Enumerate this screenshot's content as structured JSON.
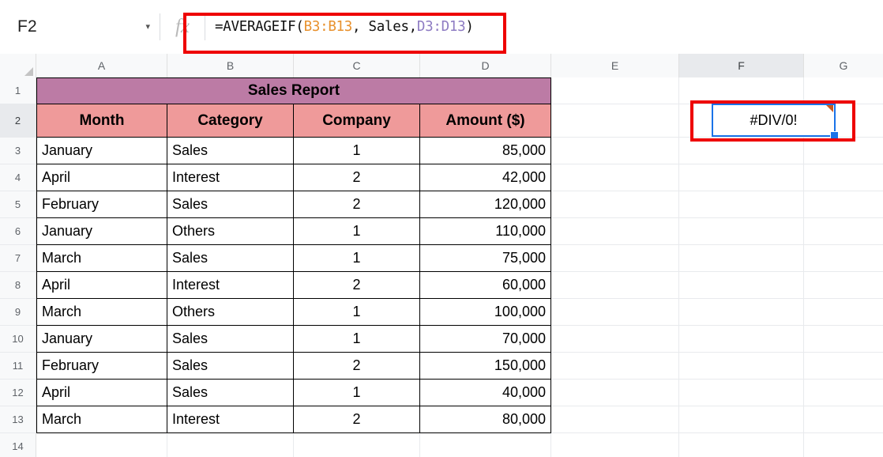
{
  "formula_bar": {
    "name_box_value": "F2",
    "name_box_caret": "▾",
    "fx_label": "fx",
    "formula_prefix": "=AVERAGEIF(",
    "formula_ref1": "B3:B13",
    "formula_mid": ", Sales,",
    "formula_ref2": "D3:D13",
    "formula_suffix": ")",
    "ref1_color": "#e8912d",
    "ref2_color": "#8e7cc3"
  },
  "grid": {
    "columns": [
      "A",
      "B",
      "C",
      "D",
      "E",
      "F",
      "G"
    ],
    "selected_column": "F",
    "selected_row": "2",
    "row_numbers": [
      "1",
      "2",
      "3",
      "4",
      "5",
      "6",
      "7",
      "8",
      "9",
      "10",
      "11",
      "12",
      "13",
      "14"
    ]
  },
  "sheet": {
    "title": "Sales Report",
    "title_bg": "#bc7ba5",
    "header_bg": "#ef9a9a",
    "headers": [
      "Month",
      "Category",
      "Company",
      "Amount ($)"
    ],
    "rows": [
      {
        "month": "January",
        "category": "Sales",
        "company": "1",
        "amount": "85,000"
      },
      {
        "month": "April",
        "category": "Interest",
        "company": "2",
        "amount": "42,000"
      },
      {
        "month": "February",
        "category": "Sales",
        "company": "2",
        "amount": "120,000"
      },
      {
        "month": "January",
        "category": "Others",
        "company": "1",
        "amount": "110,000"
      },
      {
        "month": "March",
        "category": "Sales",
        "company": "1",
        "amount": "75,000"
      },
      {
        "month": "April",
        "category": "Interest",
        "company": "2",
        "amount": "60,000"
      },
      {
        "month": "March",
        "category": "Others",
        "company": "1",
        "amount": "100,000"
      },
      {
        "month": "January",
        "category": "Sales",
        "company": "1",
        "amount": "70,000"
      },
      {
        "month": "February",
        "category": "Sales",
        "company": "2",
        "amount": "150,000"
      },
      {
        "month": "April",
        "category": "Sales",
        "company": "1",
        "amount": "40,000"
      },
      {
        "month": "March",
        "category": "Interest",
        "company": "2",
        "amount": "80,000"
      }
    ]
  },
  "selected_cell": {
    "address": "F2",
    "value": "#DIV/0!",
    "border_color": "#1a73e8",
    "error_flag_color": "#c9581f"
  },
  "annotations": {
    "highlight_color": "#ee0000",
    "formula_box_label": "formula-highlight",
    "cell_box_label": "result-cell-highlight"
  }
}
